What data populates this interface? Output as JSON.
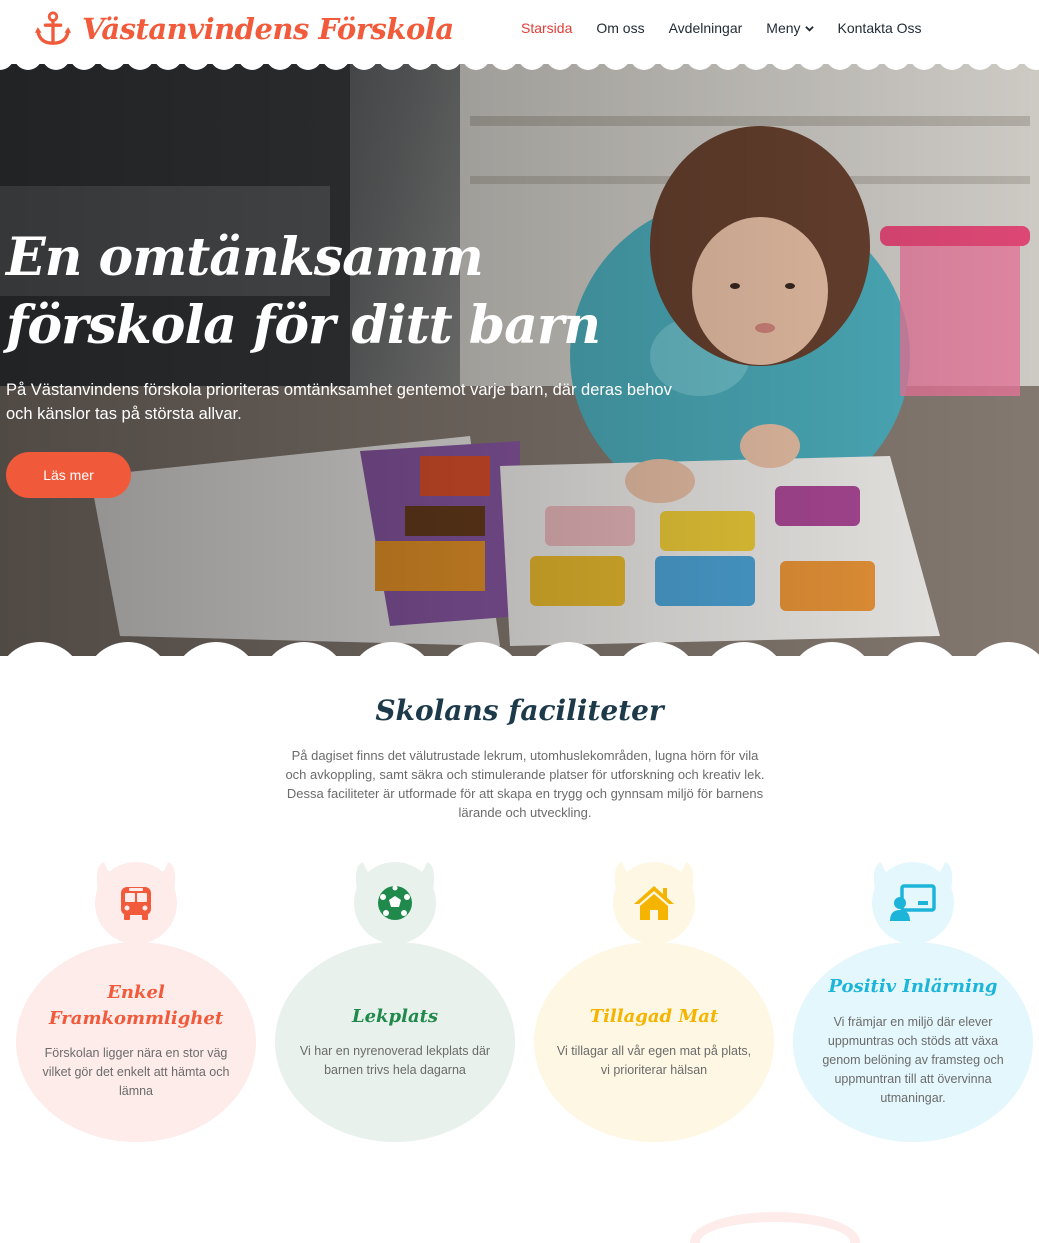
{
  "header": {
    "logo_text": "Västanvindens Förskola",
    "logo_icon": "anchor-icon",
    "nav": [
      {
        "label": "Starsida",
        "active": true
      },
      {
        "label": "Om oss",
        "active": false
      },
      {
        "label": "Avdelningar",
        "active": false
      },
      {
        "label": "Meny",
        "active": false,
        "dropdown": true
      },
      {
        "label": "Kontakta Oss",
        "active": false
      }
    ]
  },
  "hero": {
    "title": "En omtänksamm förskola för ditt barn",
    "text": "På Västanvindens förskola prioriteras omtänksamhet gentemot varje barn, där deras behov och känslor tas på största allvar.",
    "button_label": "Läs mer"
  },
  "facilities": {
    "title": "Skolans faciliteter",
    "intro": "På dagiset finns det välutrustade lekrum, utomhuslekområden, lugna hörn för vila och avkoppling, samt säkra och stimulerande platser för utforskning och kreativ lek. Dessa faciliteter är utformade för att skapa en trygg och gynnsam miljö för barnens lärande och utveckling.",
    "cards": [
      {
        "title": "Enkel Framkommlighet",
        "text": "Förskolan ligger nära en stor väg vilket gör det enkelt att hämta och lämna",
        "icon": "bus-icon",
        "accent": "#f15a3a",
        "bg": "#fdecea"
      },
      {
        "title": "Lekplats",
        "text": "Vi har en nyrenoverad lekplats där barnen trivs hela dagarna",
        "icon": "football-icon",
        "accent": "#1f8a4c",
        "bg": "#e8f1ec"
      },
      {
        "title": "Tillagad Mat",
        "text": "Vi tillagar all vår egen mat på plats, vi prioriterar hälsan",
        "icon": "house-icon",
        "accent": "#f4b400",
        "bg": "#fdf7e3"
      },
      {
        "title": "Positiv Inlärning",
        "text": "Vi främjar en miljö där elever uppmuntras och stöds att växa genom belöning av framsteg och uppmuntran till att övervinna utmaningar.",
        "icon": "teacher-board-icon",
        "accent": "#1cb5d9",
        "bg": "#e4f7fc"
      }
    ]
  }
}
